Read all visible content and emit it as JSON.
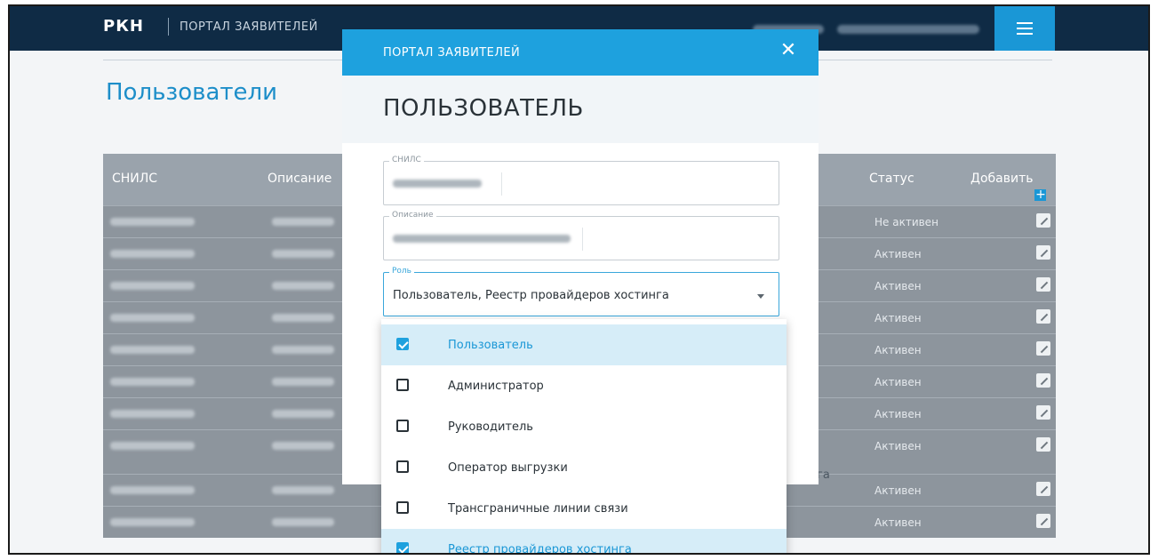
{
  "header": {
    "logo": "РКН",
    "portal_title": "ПОРТАЛ ЗАЯВИТЕЛЕЙ"
  },
  "page": {
    "title": "Пользователи"
  },
  "table": {
    "columns": {
      "snils": "СНИЛС",
      "description": "Описание",
      "status": "Статус",
      "add": "Добавить"
    },
    "rows": [
      {
        "status": "Не активен"
      },
      {
        "status": "Активен"
      },
      {
        "status": "Активен"
      },
      {
        "status": "Активен"
      },
      {
        "status": "Активен"
      },
      {
        "status": "Активен"
      },
      {
        "status": "Активен"
      },
      {
        "status": "Активен"
      },
      {
        "status": "Активен"
      },
      {
        "status": "Активен"
      }
    ],
    "stray_text": "га"
  },
  "modal": {
    "header_title": "ПОРТАЛ ЗАЯВИТЕЛЕЙ",
    "close_glyph": "✕",
    "title": "ПОЛЬЗОВАТЕЛЬ",
    "snils_label": "СНИЛС",
    "description_label": "Описание",
    "role_label": "Роль",
    "role_value": "Пользователь, Реестр провайдеров хостинга",
    "role_options": [
      {
        "label": "Пользователь",
        "checked": true
      },
      {
        "label": "Администратор",
        "checked": false
      },
      {
        "label": "Руководитель",
        "checked": false
      },
      {
        "label": "Оператор выгрузки",
        "checked": false
      },
      {
        "label": "Трансграничные линии связи",
        "checked": false
      },
      {
        "label": "Реестр провайдеров хостинга",
        "checked": true
      }
    ]
  },
  "colors": {
    "topbar": "#0f2b45",
    "accent": "#1ea1de",
    "overlay_row": "#8d959d"
  },
  "icons": {
    "menu": "hamburger-icon",
    "close": "close-icon",
    "edit": "edit-icon",
    "add": "plus-icon",
    "dropdown": "chevron-down-icon",
    "checkbox": "checkbox-icon"
  }
}
